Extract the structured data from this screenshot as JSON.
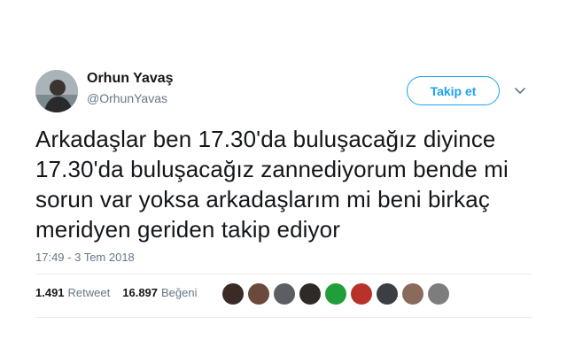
{
  "user": {
    "name": "Orhun Yavaş",
    "handle": "@OrhunYavas"
  },
  "actions": {
    "follow_label": "Takip et"
  },
  "tweet": {
    "text": "Arkadaşlar ben 17.30'da buluşacağız diyince\n17.30'da buluşacağız zannediyorum bende mi\nsorun var yoksa arkadaşlarım mi beni birkaç\nmeridyen geriden takip ediyor",
    "timestamp": "17:49 - 3 Tem 2018"
  },
  "stats": {
    "retweet_count": "1.491",
    "retweet_label": "Retweet",
    "like_count": "16.897",
    "like_label": "Beğeni"
  },
  "likers": [
    {
      "name": "liker-avatar-1",
      "color": "#3a2b27"
    },
    {
      "name": "liker-avatar-2",
      "color": "#6b4a3c"
    },
    {
      "name": "liker-avatar-3",
      "color": "#5c5f62"
    },
    {
      "name": "liker-avatar-4",
      "color": "#2e2a28"
    },
    {
      "name": "liker-avatar-5",
      "color": "#1f9e3a"
    },
    {
      "name": "liker-avatar-6",
      "color": "#b8322a"
    },
    {
      "name": "liker-avatar-7",
      "color": "#3b3f44"
    },
    {
      "name": "liker-avatar-8",
      "color": "#8a6a5a"
    },
    {
      "name": "liker-avatar-9",
      "color": "#7d7d7d"
    }
  ],
  "colors": {
    "accent": "#1da1f2",
    "secondary_text": "#657786",
    "divider": "#e6ecf0"
  }
}
